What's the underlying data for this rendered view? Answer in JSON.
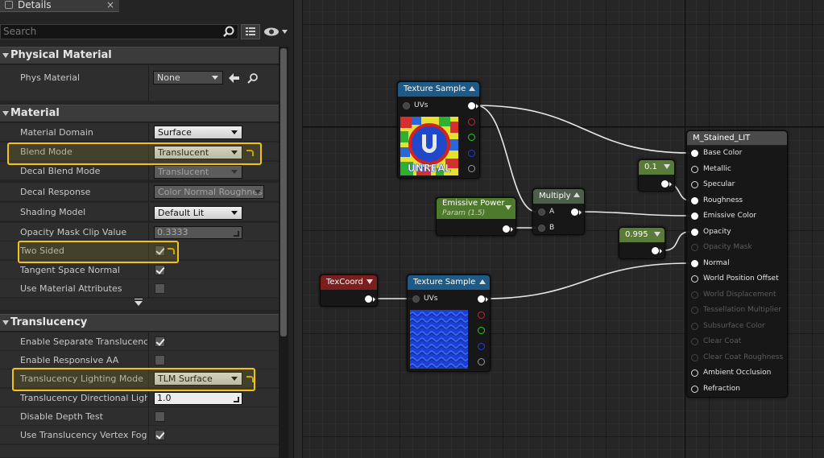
{
  "details_panel": {
    "tab_title": "Details",
    "search_placeholder": "Search",
    "categories": {
      "physical_material": "Physical Material",
      "material": "Material",
      "translucency": "Translucency"
    },
    "phys_material": {
      "label": "Phys Material",
      "value": "None"
    },
    "material_rows": {
      "material_domain": {
        "label": "Material Domain",
        "value": "Surface"
      },
      "blend_mode": {
        "label": "Blend Mode",
        "value": "Translucent"
      },
      "decal_blend_mode": {
        "label": "Decal Blend Mode",
        "value": "Translucent"
      },
      "decal_response": {
        "label": "Decal Response",
        "value": "Color Normal Roughnes"
      },
      "shading_model": {
        "label": "Shading Model",
        "value": "Default Lit"
      },
      "opacity_mask_clip": {
        "label": "Opacity Mask Clip Value",
        "value": "0.3333"
      },
      "two_sided": {
        "label": "Two Sided",
        "checked": true
      },
      "tangent_space_normal": {
        "label": "Tangent Space Normal",
        "checked": true
      },
      "use_material_attributes": {
        "label": "Use Material Attributes",
        "checked": false
      }
    },
    "translucency_rows": {
      "separate_translucency": {
        "label": "Enable Separate Translucency",
        "checked": true
      },
      "responsive_aa": {
        "label": "Enable Responsive AA",
        "checked": false
      },
      "lighting_mode": {
        "label": "Translucency Lighting Mode",
        "value": "TLM Surface"
      },
      "directional_lighting": {
        "label": "Translucency Directional Lightin",
        "value": "1.0"
      },
      "disable_depth_test": {
        "label": "Disable Depth Test",
        "checked": false
      },
      "vertex_fog": {
        "label": "Use Translucency Vertex Fog",
        "checked": true
      }
    },
    "highlight_color": "#f2c11b"
  },
  "graph": {
    "texture_sample_1": {
      "title": "Texture Sample",
      "input": "UVs",
      "header_color": "#1e5a86",
      "thumbnail": "unreal-logo-texture"
    },
    "texture_sample_2": {
      "title": "Texture Sample",
      "input": "UVs",
      "header_color": "#1e5a86",
      "thumbnail": "blue-water-normal-texture"
    },
    "emissive_power": {
      "title": "Emissive Power",
      "subtitle": "Param (1.5)",
      "header_color": "#4e7a2c"
    },
    "multiply": {
      "title": "Multiply",
      "inputs": [
        "A",
        "B"
      ],
      "header_color": "#4d5e4a"
    },
    "const_1": {
      "title": "0.1",
      "header_color": "#5a7a3a"
    },
    "const_2": {
      "title": "0.995",
      "header_color": "#5a7a3a"
    },
    "texcoord": {
      "title": "TexCoord",
      "header_color": "#7a1e1e"
    },
    "result": {
      "title": "M_Stained_LIT",
      "header_color": "#4a4a4a",
      "pins": [
        {
          "label": "Base Color",
          "enabled": true
        },
        {
          "label": "Metallic",
          "enabled": true
        },
        {
          "label": "Specular",
          "enabled": true
        },
        {
          "label": "Roughness",
          "enabled": true
        },
        {
          "label": "Emissive Color",
          "enabled": true
        },
        {
          "label": "Opacity",
          "enabled": true
        },
        {
          "label": "Opacity Mask",
          "enabled": false
        },
        {
          "label": "Normal",
          "enabled": true
        },
        {
          "label": "World Position Offset",
          "enabled": true
        },
        {
          "label": "World Displacement",
          "enabled": false
        },
        {
          "label": "Tessellation Multiplier",
          "enabled": false
        },
        {
          "label": "Subsurface Color",
          "enabled": false
        },
        {
          "label": "Clear Coat",
          "enabled": false
        },
        {
          "label": "Clear Coat Roughness",
          "enabled": false
        },
        {
          "label": "Ambient Occlusion",
          "enabled": true
        },
        {
          "label": "Refraction",
          "enabled": true
        }
      ]
    }
  }
}
